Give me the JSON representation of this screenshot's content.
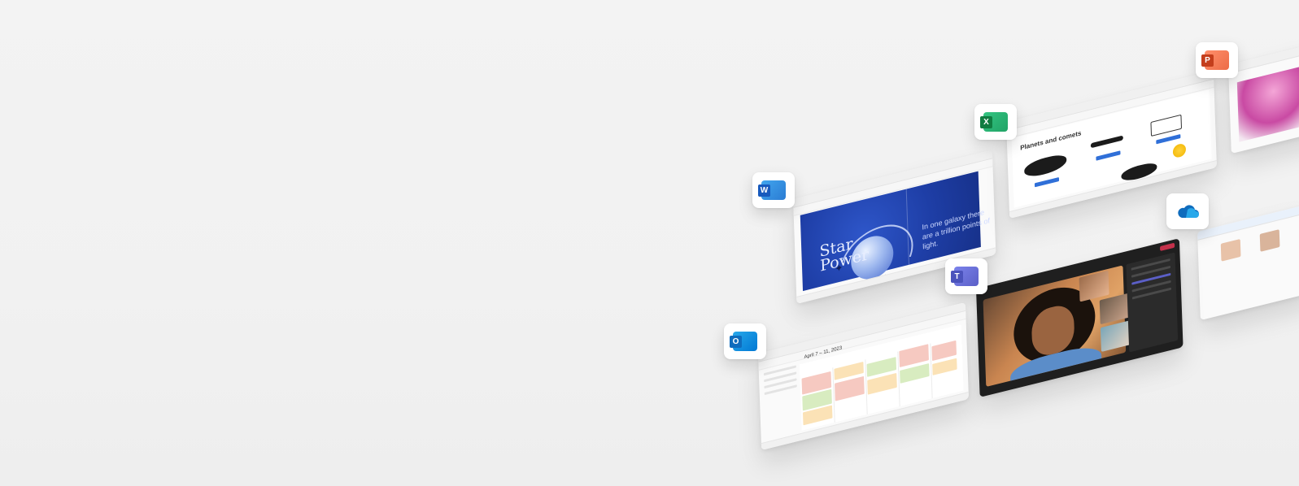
{
  "word": {
    "app_icon": "word-icon",
    "app_letter": "W",
    "color": "#185abd",
    "slide_title_line1": "Star",
    "slide_title_line2": "Power",
    "slide_caption": "In one galaxy there are a trillion points of light."
  },
  "excel": {
    "app_icon": "excel-icon",
    "app_letter": "X",
    "color": "#107c41",
    "sheet_title": "Planets and comets"
  },
  "powerpoint": {
    "app_icon": "powerpoint-icon",
    "app_letter": "P",
    "color": "#c43e1c"
  },
  "onedrive": {
    "app_icon": "onedrive-cloud-icon",
    "color": "#0f6cbd"
  },
  "teams": {
    "app_icon": "teams-icon",
    "app_letter": "T",
    "color": "#5b5fc7",
    "leave_color": "#c4314b"
  },
  "outlook": {
    "app_icon": "outlook-icon",
    "app_letter": "O",
    "color": "#0f6cbd",
    "calendar_title": "April 7 – 11, 2023"
  }
}
